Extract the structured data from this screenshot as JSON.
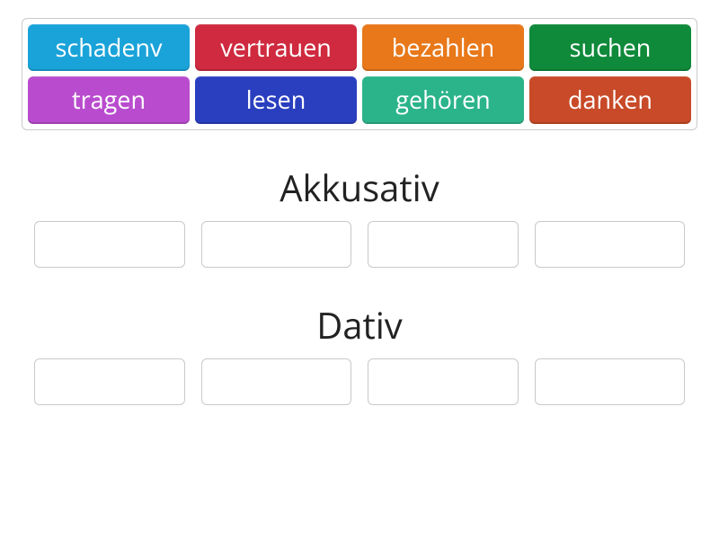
{
  "word_bank": {
    "tiles": [
      {
        "label": "schadenv",
        "color": "#1aa3d9"
      },
      {
        "label": "vertrauen",
        "color": "#cf2a3f"
      },
      {
        "label": "bezahlen",
        "color": "#e8781a"
      },
      {
        "label": "suchen",
        "color": "#0f8a3a"
      },
      {
        "label": "tragen",
        "color": "#b94cce"
      },
      {
        "label": "lesen",
        "color": "#2a3fbf"
      },
      {
        "label": "gehören",
        "color": "#2bb48a"
      },
      {
        "label": "danken",
        "color": "#c84a28"
      }
    ]
  },
  "categories": [
    {
      "title": "Akkusativ",
      "slots": 4
    },
    {
      "title": "Dativ",
      "slots": 4
    }
  ]
}
